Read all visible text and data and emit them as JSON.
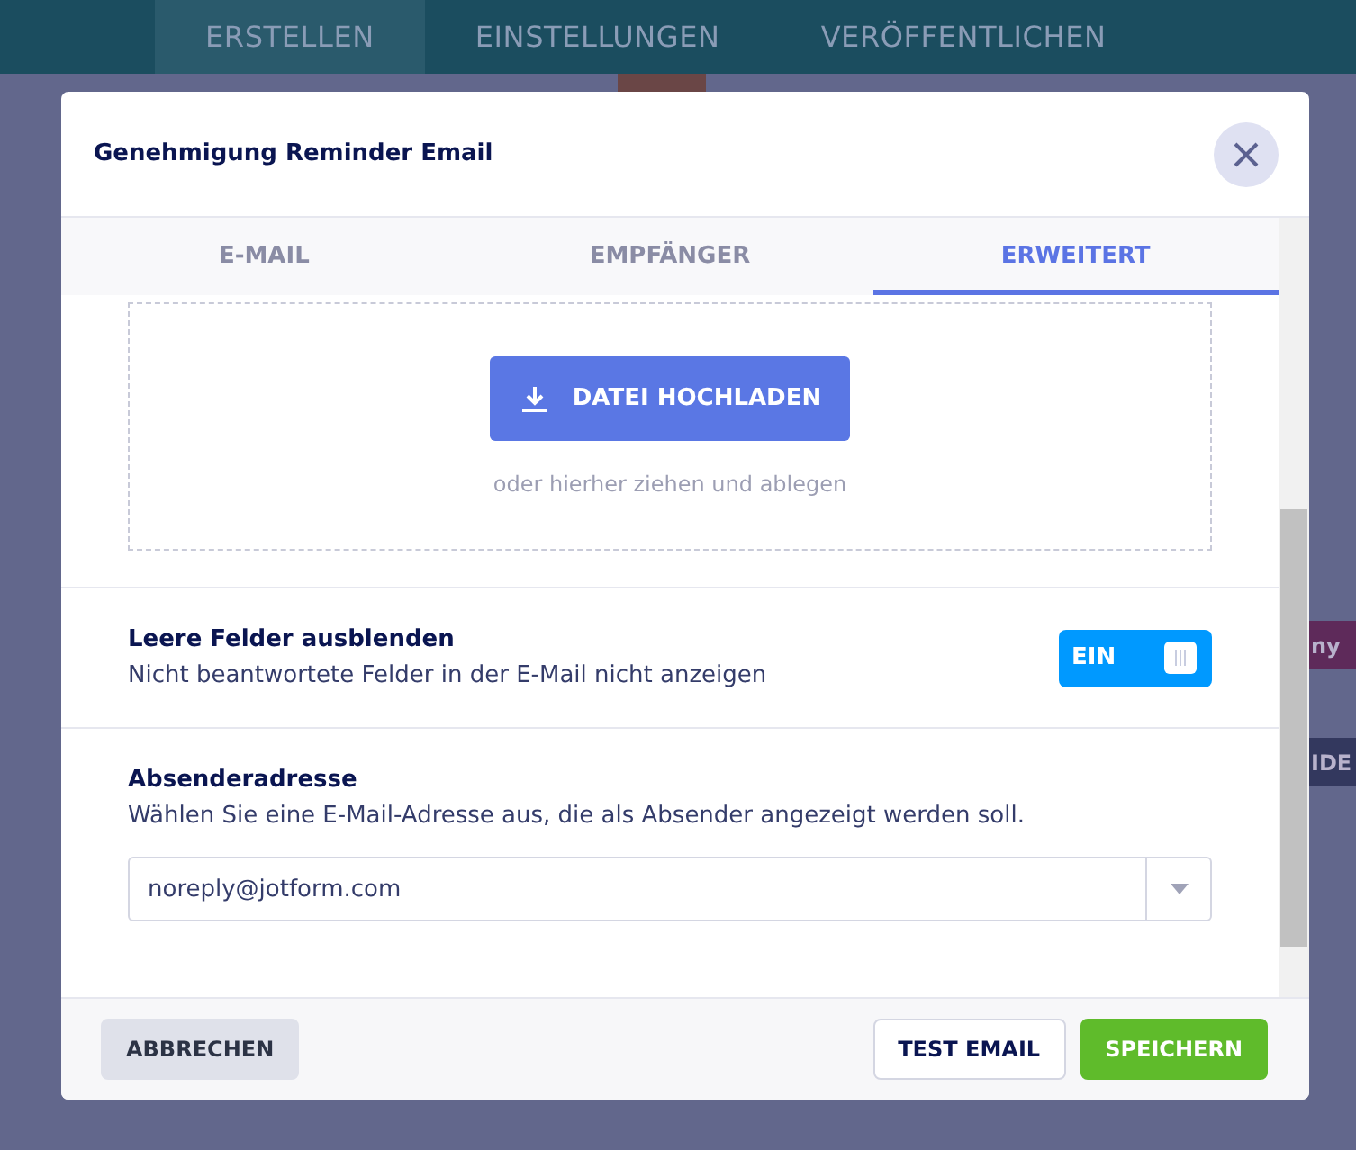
{
  "nav": [
    {
      "label": "ERSTELLEN",
      "selected": true
    },
    {
      "label": "EINSTELLUNGEN",
      "selected": false
    },
    {
      "label": "VERÖFFENTLICHEN",
      "selected": false
    }
  ],
  "background_tags": [
    {
      "label": "ny",
      "color": "#5e2a5a"
    },
    {
      "label": "IDE",
      "color": "#33385e"
    }
  ],
  "dialog": {
    "title": "Genehmigung Reminder Email",
    "tabs": [
      {
        "label": "E-MAIL",
        "selected": false
      },
      {
        "label": "EMPFÄNGER",
        "selected": false
      },
      {
        "label": "ERWEITERT",
        "selected": true
      }
    ],
    "upload": {
      "button": "DATEI HOCHLADEN",
      "hint": "oder hierher ziehen und ablegen"
    },
    "hide_empty": {
      "title": "Leere Felder ausblenden",
      "description": "Nicht beantwortete Felder in der E-Mail nicht anzeigen",
      "toggle": {
        "label": "EIN",
        "on": true
      }
    },
    "sender": {
      "title": "Absenderadresse",
      "description": "Wählen Sie eine E-Mail-Adresse aus, die als Absender angezeigt werden soll.",
      "value": "noreply@jotform.com"
    },
    "footer": {
      "cancel": "ABBRECHEN",
      "test": "TEST EMAIL",
      "save": "SPEICHERN"
    }
  }
}
